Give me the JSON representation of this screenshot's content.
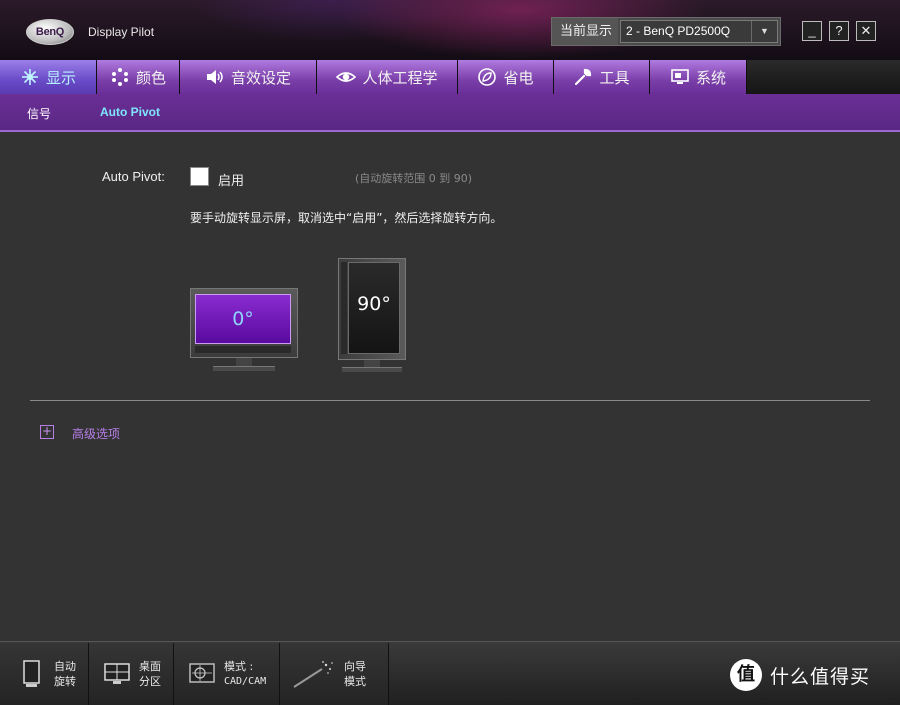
{
  "window": {
    "logo_text": "BenQ",
    "app_title": "Display Pilot",
    "current_display_label": "当前显示",
    "current_display_value": "2 - BenQ PD2500Q",
    "dropdown_arrow": "▼",
    "minimize": "_",
    "help": "?",
    "close": "✕"
  },
  "nav": {
    "tabs": [
      {
        "label": "显示",
        "icon": "display-icon",
        "active": true
      },
      {
        "label": "颜色",
        "icon": "color-dots-icon",
        "active": false
      },
      {
        "label": "音效设定",
        "icon": "speaker-icon",
        "active": false
      },
      {
        "label": "人体工程学",
        "icon": "eye-icon",
        "active": false
      },
      {
        "label": "省电",
        "icon": "leaf-icon",
        "active": false
      },
      {
        "label": "工具",
        "icon": "wrench-icon",
        "active": false
      },
      {
        "label": "系统",
        "icon": "system-monitor-icon",
        "active": false
      }
    ]
  },
  "subnav": {
    "items": [
      {
        "label": "信号",
        "active": false
      },
      {
        "label": "Auto Pivot",
        "active": true
      }
    ]
  },
  "auto_pivot": {
    "label": "Auto Pivot:",
    "enable_label": "启用",
    "enabled": false,
    "range_note": "(自动旋转范围 0 到 90)",
    "instruction": "要手动旋转显示屏，取消选中“启用”，然后选择旋转方向。",
    "orientations": [
      {
        "label": "0°",
        "selected": true
      },
      {
        "label": "90°",
        "selected": false
      }
    ]
  },
  "advanced": {
    "icon": "+",
    "label": "高级选项"
  },
  "bottom_bar": {
    "buttons": [
      {
        "line1": "自动",
        "line2": "旋转",
        "icon": "portrait-monitor-icon"
      },
      {
        "line1": "桌面",
        "line2": "分区",
        "icon": "split-desktop-icon"
      },
      {
        "line1": "模式 :",
        "line2": "CAD/CAM",
        "icon": "cad-mode-icon"
      },
      {
        "line1": "向导",
        "line2": "模式",
        "icon": "magic-wand-icon"
      }
    ]
  },
  "watermark": {
    "badge": "值",
    "text": "什么值得买"
  },
  "colors": {
    "tab_purple": "#7a3ea8",
    "tab_active": "#6a4bc8",
    "subnav_purple": "#5a2784",
    "content_bg": "#333333",
    "accent_cyan": "#7ee6ff",
    "link_purple": "#b77ee8",
    "screen_purple": "#6a14b0"
  }
}
